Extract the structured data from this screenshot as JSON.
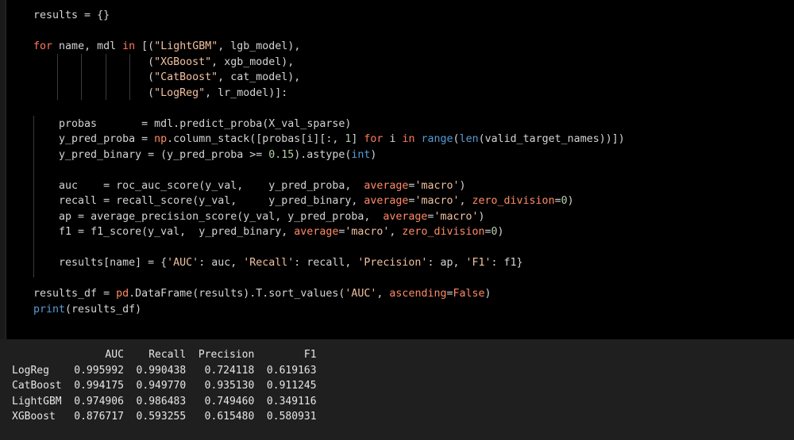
{
  "code_cell": {
    "lines": [
      "results = {}",
      "",
      "for name, mdl in [(\"LightGBM\", lgb_model),",
      "                  (\"XGBoost\", xgb_model),",
      "                  (\"CatBoost\", cat_model),",
      "                  (\"LogReg\", lr_model)]:",
      "",
      "    probas       = mdl.predict_proba(X_val_sparse)",
      "    y_pred_proba = np.column_stack([probas[i][:, 1] for i in range(len(valid_target_names))])",
      "    y_pred_binary = (y_pred_proba >= 0.15).astype(int)",
      "",
      "    auc    = roc_auc_score(y_val,    y_pred_proba,  average='macro')",
      "    recall = recall_score(y_val,     y_pred_binary, average='macro', zero_division=0)",
      "    ap = average_precision_score(y_val, y_pred_proba,  average='macro')",
      "    f1 = f1_score(y_val,  y_pred_binary, average='macro', zero_division=0)",
      "",
      "    results[name] = {'AUC': auc, 'Recall': recall, 'Precision': ap, 'F1': f1}",
      "",
      "results_df = pd.DataFrame(results).T.sort_values('AUC', ascending=False)",
      "print(results_df)"
    ]
  },
  "output": {
    "columns": [
      "AUC",
      "Recall",
      "Precision",
      "F1"
    ],
    "rows": [
      {
        "name": "LogReg",
        "values": [
          "0.995992",
          "0.990438",
          "0.724118",
          "0.619163"
        ]
      },
      {
        "name": "CatBoost",
        "values": [
          "0.994175",
          "0.949770",
          "0.935130",
          "0.911245"
        ]
      },
      {
        "name": "LightGBM",
        "values": [
          "0.974906",
          "0.986483",
          "0.749460",
          "0.349116"
        ]
      },
      {
        "name": "XGBoost",
        "values": [
          "0.876717",
          "0.593255",
          "0.615480",
          "0.580931"
        ]
      }
    ]
  },
  "colors": {
    "cell_background": "#000000",
    "output_background": "#1f1f1f",
    "keyword": "#ff7b5c",
    "string": "#f1c0a0",
    "text": "#d4d4d4"
  }
}
